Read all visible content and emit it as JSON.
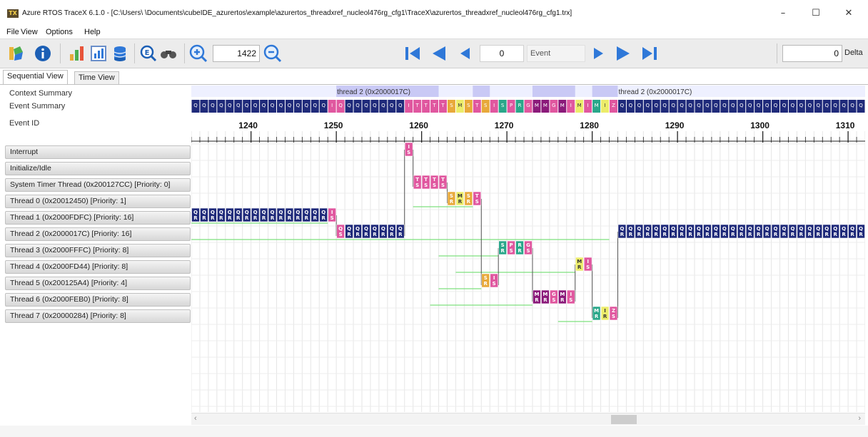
{
  "window": {
    "title": "Azure RTOS TraceX 6.1.0 - [C:\\Users\\        \\Documents\\cubeIDE_azurertos\\example\\azurertos_threadxref_nucleol476rg_cfg1\\TraceX\\azurertos_threadxref_nucleol476rg_cfg1.trx]",
    "app_icon_text": "TX",
    "minimize": "–",
    "maximize": "☐",
    "close": "✕"
  },
  "menu": [
    "File",
    "View",
    "Options",
    "Help"
  ],
  "toolbar": {
    "zoom_value": "1422",
    "event_index": "0",
    "event_label": "Event",
    "delta_value": "0",
    "delta_label": "Delta",
    "colors": {
      "nav_blue": "#2f78d8",
      "info_blue": "#1c5fb5"
    }
  },
  "tabs": [
    "Sequential View",
    "Time View"
  ],
  "header_rows": {
    "context_summary": "Context Summary",
    "event_summary": "Event Summary",
    "event_id": "Event ID"
  },
  "context_labels": [
    {
      "event": 1250,
      "text": "thread 2 (0x2000017C)"
    },
    {
      "event": 1283,
      "text": "thread 2 (0x2000017C)"
    }
  ],
  "rows": [
    "Interrupt",
    "Initialize/Idle",
    "System Timer Thread (0x200127CC) [Priority: 0]",
    "Thread 0 (0x20012450) [Priority: 1]",
    "Thread 1 (0x2000FDFC) [Priority: 16]",
    "Thread 2 (0x2000017C) [Priority: 16]",
    "Thread 3 (0x2000FFFC) [Priority: 8]",
    "Thread 4 (0x2000FD44) [Priority: 8]",
    "Thread 5 (0x200125A4) [Priority: 4]",
    "Thread 6 (0x2000FEB0) [Priority: 8]",
    "Thread 7 (0x20000284) [Priority: 8]"
  ],
  "axis": {
    "first_event": 1233,
    "last_event": 1311,
    "major_labels": [
      1240,
      1250,
      1260,
      1270,
      1280,
      1290,
      1300,
      1310
    ]
  },
  "event_colors": {
    "queue": "#1f2a7a",
    "isr": "#e0579f",
    "sem": "#e8a93a",
    "mutex": "#8b1a7a",
    "flag": "#ecec6a",
    "resume": "#2aa78a",
    "running_line": "#7ee07e"
  },
  "events": [
    {
      "row": 4,
      "from": 1233,
      "to": 1248,
      "kind": "queue",
      "text": "Q"
    },
    {
      "row": 4,
      "from": 1249,
      "to": 1249,
      "kind": "isr",
      "text": "I"
    },
    {
      "row": 5,
      "from": 1250,
      "to": 1250,
      "kind": "isr",
      "text": "Q"
    },
    {
      "row": 5,
      "from": 1251,
      "to": 1257,
      "kind": "queue",
      "text": "Q"
    },
    {
      "row": 0,
      "from": 1258,
      "to": 1258,
      "kind": "isr",
      "text": "I"
    },
    {
      "row": 2,
      "from": 1259,
      "to": 1262,
      "kind": "isr",
      "text": "T"
    },
    {
      "row": 3,
      "from": 1263,
      "to": 1263,
      "kind": "sem",
      "text": "S"
    },
    {
      "row": 3,
      "from": 1264,
      "to": 1264,
      "kind": "flag",
      "text": "M"
    },
    {
      "row": 3,
      "from": 1265,
      "to": 1265,
      "kind": "sem",
      "text": "S"
    },
    {
      "row": 3,
      "from": 1266,
      "to": 1266,
      "kind": "isr",
      "text": "T"
    },
    {
      "row": 8,
      "from": 1267,
      "to": 1267,
      "kind": "sem",
      "text": "S"
    },
    {
      "row": 8,
      "from": 1268,
      "to": 1268,
      "kind": "isr",
      "text": "I"
    },
    {
      "row": 6,
      "from": 1269,
      "to": 1269,
      "kind": "resume",
      "text": "S"
    },
    {
      "row": 6,
      "from": 1270,
      "to": 1270,
      "kind": "isr",
      "text": "P"
    },
    {
      "row": 6,
      "from": 1271,
      "to": 1271,
      "kind": "resume",
      "text": "R"
    },
    {
      "row": 6,
      "from": 1272,
      "to": 1272,
      "kind": "isr",
      "text": "G"
    },
    {
      "row": 9,
      "from": 1273,
      "to": 1274,
      "kind": "mutex",
      "text": "M"
    },
    {
      "row": 9,
      "from": 1275,
      "to": 1275,
      "kind": "isr",
      "text": "G"
    },
    {
      "row": 9,
      "from": 1276,
      "to": 1276,
      "kind": "mutex",
      "text": "M"
    },
    {
      "row": 9,
      "from": 1277,
      "to": 1277,
      "kind": "isr",
      "text": "I"
    },
    {
      "row": 7,
      "from": 1278,
      "to": 1278,
      "kind": "flag",
      "text": "M"
    },
    {
      "row": 7,
      "from": 1279,
      "to": 1279,
      "kind": "isr",
      "text": "I"
    },
    {
      "row": 10,
      "from": 1280,
      "to": 1280,
      "kind": "resume",
      "text": "M"
    },
    {
      "row": 10,
      "from": 1281,
      "to": 1281,
      "kind": "flag",
      "text": "I"
    },
    {
      "row": 10,
      "from": 1282,
      "to": 1282,
      "kind": "isr",
      "text": "Z"
    },
    {
      "row": 5,
      "from": 1283,
      "to": 1311,
      "kind": "queue",
      "text": "Q"
    }
  ]
}
